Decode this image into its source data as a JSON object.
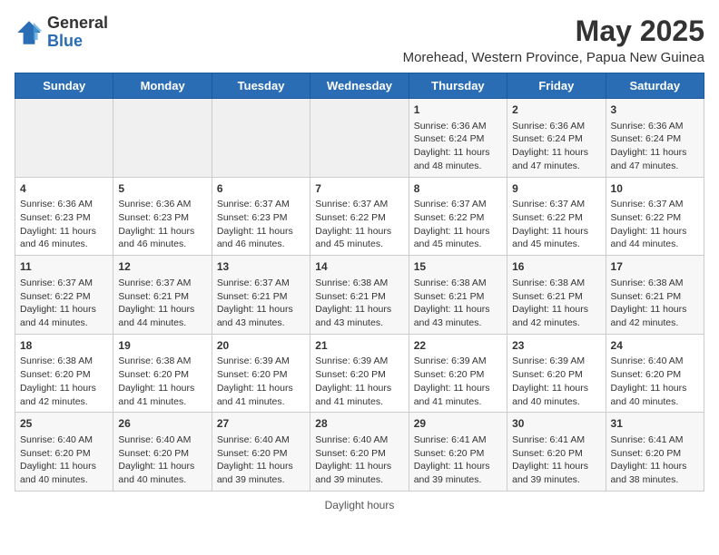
{
  "header": {
    "logo_general": "General",
    "logo_blue": "Blue",
    "month_year": "May 2025",
    "location": "Morehead, Western Province, Papua New Guinea"
  },
  "days_of_week": [
    "Sunday",
    "Monday",
    "Tuesday",
    "Wednesday",
    "Thursday",
    "Friday",
    "Saturday"
  ],
  "weeks": [
    [
      {
        "day": "",
        "info": ""
      },
      {
        "day": "",
        "info": ""
      },
      {
        "day": "",
        "info": ""
      },
      {
        "day": "",
        "info": ""
      },
      {
        "day": "1",
        "info": "Sunrise: 6:36 AM\nSunset: 6:24 PM\nDaylight: 11 hours and 48 minutes."
      },
      {
        "day": "2",
        "info": "Sunrise: 6:36 AM\nSunset: 6:24 PM\nDaylight: 11 hours and 47 minutes."
      },
      {
        "day": "3",
        "info": "Sunrise: 6:36 AM\nSunset: 6:24 PM\nDaylight: 11 hours and 47 minutes."
      }
    ],
    [
      {
        "day": "4",
        "info": "Sunrise: 6:36 AM\nSunset: 6:23 PM\nDaylight: 11 hours and 46 minutes."
      },
      {
        "day": "5",
        "info": "Sunrise: 6:36 AM\nSunset: 6:23 PM\nDaylight: 11 hours and 46 minutes."
      },
      {
        "day": "6",
        "info": "Sunrise: 6:37 AM\nSunset: 6:23 PM\nDaylight: 11 hours and 46 minutes."
      },
      {
        "day": "7",
        "info": "Sunrise: 6:37 AM\nSunset: 6:22 PM\nDaylight: 11 hours and 45 minutes."
      },
      {
        "day": "8",
        "info": "Sunrise: 6:37 AM\nSunset: 6:22 PM\nDaylight: 11 hours and 45 minutes."
      },
      {
        "day": "9",
        "info": "Sunrise: 6:37 AM\nSunset: 6:22 PM\nDaylight: 11 hours and 45 minutes."
      },
      {
        "day": "10",
        "info": "Sunrise: 6:37 AM\nSunset: 6:22 PM\nDaylight: 11 hours and 44 minutes."
      }
    ],
    [
      {
        "day": "11",
        "info": "Sunrise: 6:37 AM\nSunset: 6:22 PM\nDaylight: 11 hours and 44 minutes."
      },
      {
        "day": "12",
        "info": "Sunrise: 6:37 AM\nSunset: 6:21 PM\nDaylight: 11 hours and 44 minutes."
      },
      {
        "day": "13",
        "info": "Sunrise: 6:37 AM\nSunset: 6:21 PM\nDaylight: 11 hours and 43 minutes."
      },
      {
        "day": "14",
        "info": "Sunrise: 6:38 AM\nSunset: 6:21 PM\nDaylight: 11 hours and 43 minutes."
      },
      {
        "day": "15",
        "info": "Sunrise: 6:38 AM\nSunset: 6:21 PM\nDaylight: 11 hours and 43 minutes."
      },
      {
        "day": "16",
        "info": "Sunrise: 6:38 AM\nSunset: 6:21 PM\nDaylight: 11 hours and 42 minutes."
      },
      {
        "day": "17",
        "info": "Sunrise: 6:38 AM\nSunset: 6:21 PM\nDaylight: 11 hours and 42 minutes."
      }
    ],
    [
      {
        "day": "18",
        "info": "Sunrise: 6:38 AM\nSunset: 6:20 PM\nDaylight: 11 hours and 42 minutes."
      },
      {
        "day": "19",
        "info": "Sunrise: 6:38 AM\nSunset: 6:20 PM\nDaylight: 11 hours and 41 minutes."
      },
      {
        "day": "20",
        "info": "Sunrise: 6:39 AM\nSunset: 6:20 PM\nDaylight: 11 hours and 41 minutes."
      },
      {
        "day": "21",
        "info": "Sunrise: 6:39 AM\nSunset: 6:20 PM\nDaylight: 11 hours and 41 minutes."
      },
      {
        "day": "22",
        "info": "Sunrise: 6:39 AM\nSunset: 6:20 PM\nDaylight: 11 hours and 41 minutes."
      },
      {
        "day": "23",
        "info": "Sunrise: 6:39 AM\nSunset: 6:20 PM\nDaylight: 11 hours and 40 minutes."
      },
      {
        "day": "24",
        "info": "Sunrise: 6:40 AM\nSunset: 6:20 PM\nDaylight: 11 hours and 40 minutes."
      }
    ],
    [
      {
        "day": "25",
        "info": "Sunrise: 6:40 AM\nSunset: 6:20 PM\nDaylight: 11 hours and 40 minutes."
      },
      {
        "day": "26",
        "info": "Sunrise: 6:40 AM\nSunset: 6:20 PM\nDaylight: 11 hours and 40 minutes."
      },
      {
        "day": "27",
        "info": "Sunrise: 6:40 AM\nSunset: 6:20 PM\nDaylight: 11 hours and 39 minutes."
      },
      {
        "day": "28",
        "info": "Sunrise: 6:40 AM\nSunset: 6:20 PM\nDaylight: 11 hours and 39 minutes."
      },
      {
        "day": "29",
        "info": "Sunrise: 6:41 AM\nSunset: 6:20 PM\nDaylight: 11 hours and 39 minutes."
      },
      {
        "day": "30",
        "info": "Sunrise: 6:41 AM\nSunset: 6:20 PM\nDaylight: 11 hours and 39 minutes."
      },
      {
        "day": "31",
        "info": "Sunrise: 6:41 AM\nSunset: 6:20 PM\nDaylight: 11 hours and 38 minutes."
      }
    ]
  ],
  "footer": {
    "daylight_label": "Daylight hours"
  }
}
